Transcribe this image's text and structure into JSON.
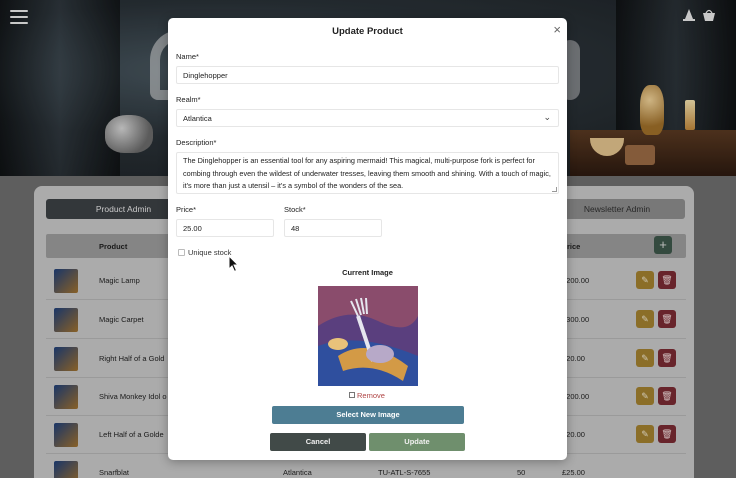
{
  "background": {
    "tabs": {
      "product_admin": "Product Admin",
      "newsletter_admin": "Newsletter Admin"
    },
    "table": {
      "headers": {
        "product": "Product",
        "price": "Price"
      },
      "add_label": "+",
      "rows": [
        {
          "name": "Magic Lamp",
          "price": "£200.00"
        },
        {
          "name": "Magic Carpet",
          "price": "£300.00"
        },
        {
          "name": "Right Half of a Gold",
          "price": "£20.00"
        },
        {
          "name": "Shiva Monkey Idol o",
          "price": "£200.00"
        },
        {
          "name": "Left Half of a Golde",
          "price": "£20.00"
        },
        {
          "name": "Snarfblat",
          "realm": "Atlantica",
          "sku": "TU-ATL-S-7655",
          "stock": "50",
          "price": "£25.00"
        }
      ]
    }
  },
  "modal": {
    "title": "Update Product",
    "close_label": "×",
    "name_label": "Name*",
    "name_value": "Dinglehopper",
    "realm_label": "Realm*",
    "realm_value": "Atlantica",
    "description_label": "Description*",
    "description_value": "The Dinglehopper is an essential tool for any aspiring mermaid! This magical, multi-purpose fork is perfect for combing through even the wildest of underwater tresses, leaving them smooth and shining. With a touch of magic, it's more than just a utensil – it's a symbol of the wonders of the sea.",
    "price_label": "Price*",
    "price_value": "25.00",
    "stock_label": "Stock*",
    "stock_value": "48",
    "unique_stock_label": "Unique stock",
    "current_image_label": "Current Image",
    "remove_label": "Remove",
    "select_image_label": "Select New Image",
    "cancel_label": "Cancel",
    "update_label": "Update"
  },
  "colors": {
    "select_button": "#4d7d93",
    "cancel_button": "#414a48",
    "update_button": "#6f8f6d",
    "remove_text": "#b04545"
  }
}
